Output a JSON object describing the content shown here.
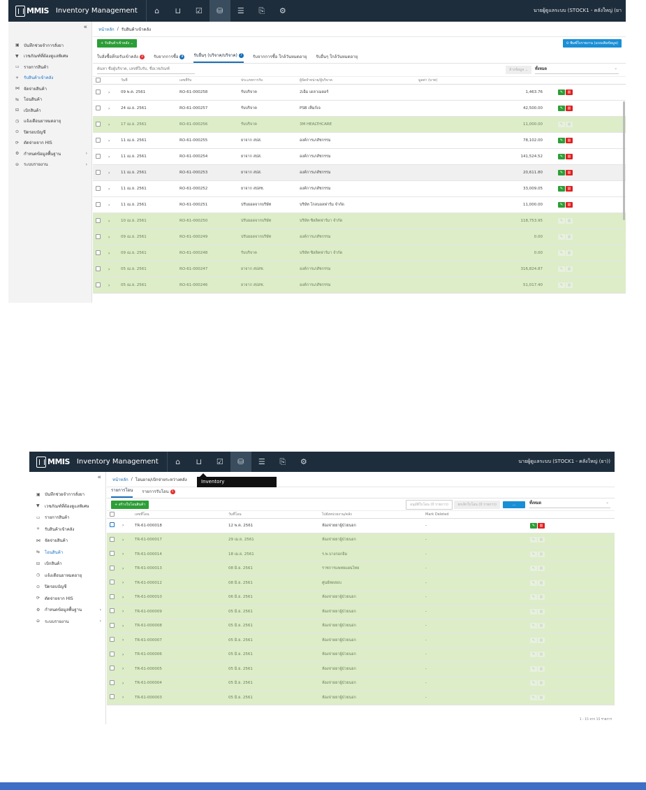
{
  "app": {
    "title": "Inventory Management",
    "logo_text": "MMIS"
  },
  "screen1": {
    "user": "นายผู้ดูแลระบบ (STOCK1 - คลังใหญ่ (ยา",
    "breadcrumb": {
      "home": "หน้าหลัก",
      "sep": "/",
      "current": "รับสินค้าเข้าคลัง"
    },
    "create_button": "+ รับสินค้าเข้าคลัง ⌄",
    "print_button": "⊙ พิมพ์ใบรายงาน (แบบเติมข้อมูล)",
    "tabs": [
      {
        "label": "ใบสั่งซื้อที่รอรับเข้าคลัง",
        "badge": "3",
        "badge_color": "red"
      },
      {
        "label": "รับจากการซื้อ",
        "badge": "8",
        "badge_color": "blue"
      },
      {
        "label": "รับอื่นๆ (บริจาค/บริจาค)",
        "badge": "7",
        "badge_color": "blue"
      },
      {
        "label": "รับจากการซื้อ ใกล้วันหมดอายุ",
        "badge": "",
        "badge_color": ""
      },
      {
        "label": "รับอื่นๆ ใกล้วันหมดอายุ",
        "badge": "",
        "badge_color": ""
      }
    ],
    "search_placeholder": "ค้นหา ชื่อผู้บริจาค, เลขที่ใบรับ, ชื่อเวชภัณฑ์",
    "filter_button": "ล้างข้อมูล ⌄",
    "status_select": "ทั้งหมด",
    "columns": [
      "",
      "",
      "วันที่",
      "เลขที่รับ",
      "ประเภทการรับ",
      "ผู้จัดจำหน่าย/ผู้บริจาค",
      "มูลค่า (บาท)",
      ""
    ],
    "rows": [
      {
        "date": "09 พ.ค. 2561",
        "no": "RO-61-000258",
        "type": "รับบริจาค",
        "vendor": "2เอ็ม เดลาเมดอร์",
        "value": "1,463.76",
        "green": false
      },
      {
        "date": "24 เม.ย. 2561",
        "no": "RO-61-000257",
        "type": "รับบริจาค",
        "vendor": "PSB เท็มก์เจ",
        "value": "42,500.00",
        "green": false
      },
      {
        "date": "17 เม.ย. 2561",
        "no": "RO-61-000256",
        "type": "รับบริจาค",
        "vendor": "3M HEALTHCARE",
        "value": "11,000.00",
        "green": true
      },
      {
        "date": "11 เม.ย. 2561",
        "no": "RO-61-000255",
        "type": "ยาจาก สปส.",
        "vendor": "องค์การเภสัชกรรม",
        "value": "78,102.00",
        "green": false
      },
      {
        "date": "11 เม.ย. 2561",
        "no": "RO-61-000254",
        "type": "ยาจาก สปส.",
        "vendor": "องค์การเภสัชกรรม",
        "value": "141,524.52",
        "green": false
      },
      {
        "date": "11 เม.ย. 2561",
        "no": "RO-61-000253",
        "type": "ยาจาก สปส.",
        "vendor": "องค์การเภสัชกรรม",
        "value": "20,611.80",
        "green": false,
        "grey": true
      },
      {
        "date": "11 เม.ย. 2561",
        "no": "RO-61-000252",
        "type": "ยาจาก สปสช.",
        "vendor": "องค์การเภสัชกรรม",
        "value": "33,009.05",
        "green": false
      },
      {
        "date": "11 เม.ย. 2561",
        "no": "RO-61-000251",
        "type": "ปรับยอดจากบริษัท",
        "vendor": "บริษัท โกลบอลฟาร์ม จำกัด",
        "value": "11,000.00",
        "green": false
      },
      {
        "date": "10 เม.ย. 2561",
        "no": "RO-61-000250",
        "type": "ปรับยอดจากบริษัท",
        "vendor": "บริษัท ซิลลิคฟาร์มา จำกัด",
        "value": "118,753.95",
        "green": true
      },
      {
        "date": "09 เม.ย. 2561",
        "no": "RO-61-000249",
        "type": "ปรับยอดจากบริษัท",
        "vendor": "องค์การเภสัชกรรม",
        "value": "0.00",
        "green": true
      },
      {
        "date": "09 เม.ย. 2561",
        "no": "RO-61-000248",
        "type": "รับบริจาค",
        "vendor": "บริษัท ซิลลิคฟาร์มา จำกัด",
        "value": "0.00",
        "green": true
      },
      {
        "date": "05 เม.ย. 2561",
        "no": "RO-61-000247",
        "type": "ยาจาก สปสช.",
        "vendor": "องค์การเภสัชกรรม",
        "value": "316,824.87",
        "green": true
      },
      {
        "date": "05 เม.ย. 2561",
        "no": "RO-61-000246",
        "type": "ยาจาก สปสช.",
        "vendor": "องค์การเภสัชกรรม",
        "value": "51,017.40",
        "green": true
      }
    ]
  },
  "screen2": {
    "user": "นายผู้ดูแลระบบ (STOCK1 - คลังใหญ่ (ยา))",
    "tooltip": "Inventory",
    "breadcrumb": {
      "home": "หน้าหลัก",
      "sep": "/",
      "current": "โอนยาย/เบิกจ่ายระหว่างคลัง"
    },
    "tabs": [
      {
        "label": "รายการโอน",
        "badge": "",
        "badge_color": ""
      },
      {
        "label": "รายการรับโอน",
        "badge": "1",
        "badge_color": "red"
      }
    ],
    "create_button": "+ สร้างใบโอนสินค้า",
    "btn_a": "อนุมัติใบโอน (0 รายการ)",
    "btn_b": "ยกเลิกใบโอน (0 รายการ)",
    "btn_c": "...",
    "status_select": "ทั้งหมด",
    "columns": [
      "",
      "",
      "เลขที่โอน",
      "วันที่โอน",
      "ไปยังหน่วยงาน/คลัง",
      "Mark Deleted",
      ""
    ],
    "rows": [
      {
        "no": "TR-61-000018",
        "date": "12 พ.ค. 2561",
        "dest": "ห้องจ่ายยาผู้ป่วยนอก",
        "mark": "-",
        "green": false
      },
      {
        "no": "TR-61-000017",
        "date": "29 เม.ย. 2561",
        "dest": "ห้องจ่ายยาผู้ป่วยนอก",
        "mark": "-",
        "green": true
      },
      {
        "no": "TR-61-000014",
        "date": "18 เม.ย. 2561",
        "dest": "ร.พ.บางกอกอิม",
        "mark": "-",
        "green": true
      },
      {
        "no": "TR-61-000013",
        "date": "08 มิ.ย. 2561",
        "dest": "ราชการแพทยแผนไทย",
        "mark": "-",
        "green": true
      },
      {
        "no": "TR-61-000012",
        "date": "08 มิ.ย. 2561",
        "dest": "ศูนย์ทดสอบ",
        "mark": "-",
        "green": true
      },
      {
        "no": "TR-61-000010",
        "date": "06 มิ.ย. 2561",
        "dest": "ห้องจ่ายยาผู้ป่วยนอก",
        "mark": "-",
        "green": true
      },
      {
        "no": "TR-61-000009",
        "date": "05 มิ.ย. 2561",
        "dest": "ห้องจ่ายยาผู้ป่วยนอก",
        "mark": "-",
        "green": true
      },
      {
        "no": "TR-61-000008",
        "date": "05 มิ.ย. 2561",
        "dest": "ห้องจ่ายยาผู้ป่วยนอก",
        "mark": "-",
        "green": true
      },
      {
        "no": "TR-61-000007",
        "date": "05 มิ.ย. 2561",
        "dest": "ห้องจ่ายยาผู้ป่วยนอก",
        "mark": "-",
        "green": true
      },
      {
        "no": "TR-61-000006",
        "date": "05 มิ.ย. 2561",
        "dest": "ห้องจ่ายยาผู้ป่วยนอก",
        "mark": "-",
        "green": true
      },
      {
        "no": "TR-61-000005",
        "date": "05 มิ.ย. 2561",
        "dest": "ห้องจ่ายยาผู้ป่วยนอก",
        "mark": "-",
        "green": true
      },
      {
        "no": "TR-61-000004",
        "date": "05 มิ.ย. 2561",
        "dest": "ห้องจ่ายยาผู้ป่วยนอก",
        "mark": "-",
        "green": true
      },
      {
        "no": "TR-61-000003",
        "date": "05 มิ.ย. 2561",
        "dest": "ห้องจ่ายยาผู้ป่วยนอก",
        "mark": "-",
        "green": true
      }
    ],
    "pagination": "1 - 15 จาก 15 รายการ"
  },
  "sidebar": {
    "collapse_icon": "«",
    "items": [
      {
        "icon": "clipboard-icon",
        "glyph": "▣",
        "label": "บันทึกช่วยจำการสั่งยา"
      },
      {
        "icon": "alert-icon",
        "glyph": "▼",
        "label": "เวชภัณฑ์ที่ต้องดูแลพิเศษ"
      },
      {
        "icon": "list-icon",
        "glyph": "▭",
        "label": "รายการสินค้า"
      },
      {
        "icon": "plus-icon",
        "glyph": "+",
        "label": "รับสินค้าเข้าคลัง"
      },
      {
        "icon": "issue-icon",
        "glyph": "⋈",
        "label": "จัดจ่ายสินค้า"
      },
      {
        "icon": "transfer-icon",
        "glyph": "⇆",
        "label": "โอนสินค้า"
      },
      {
        "icon": "box-icon",
        "glyph": "⊟",
        "label": "เบิกสินค้า"
      },
      {
        "icon": "bell-icon",
        "glyph": "◷",
        "label": "แจ้งเตือนยาหมดอายุ"
      },
      {
        "icon": "check-icon",
        "glyph": "⊙",
        "label": "ปิดรอบบัญชี"
      },
      {
        "icon": "his-icon",
        "glyph": "⟳",
        "label": "ตัดจ่ายจาก HIS"
      },
      {
        "icon": "settings-icon",
        "glyph": "⚙",
        "label": "กำหนดข้อมูลพื้นฐาน",
        "arrow": "›"
      },
      {
        "icon": "report-icon",
        "glyph": "⊖",
        "label": "ระบบรายงาน",
        "arrow": "›"
      }
    ]
  },
  "topicons": [
    {
      "name": "home-icon",
      "glyph": "⌂"
    },
    {
      "name": "cart-icon",
      "glyph": "⊔"
    },
    {
      "name": "checkbox-icon",
      "glyph": "☑"
    },
    {
      "name": "inventory-icon",
      "glyph": "⛁"
    },
    {
      "name": "database-icon",
      "glyph": "☰"
    },
    {
      "name": "document-icon",
      "glyph": "⎘"
    },
    {
      "name": "gear-icon",
      "glyph": "⚙"
    }
  ],
  "colors": {
    "topbar": "#1e2d3b",
    "green_row": "#dcedc8",
    "accent": "#1a6fb8",
    "footer_bar": "#3f6fc4"
  }
}
